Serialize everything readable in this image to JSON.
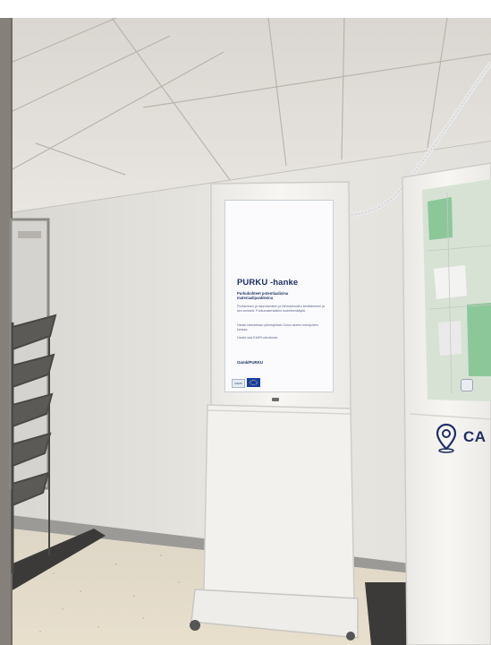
{
  "kiosk_screen": {
    "title": "PURKU -hanke",
    "subtitle": "Purkukohteet potentiaalisina materiaalipankkeina",
    "paragraph_1": "Purkamisen ja rakentamisen ja kiertotalouden kehittäminen ja sen arviointi. Purkumateriaalien uudelleenkäyttö.",
    "paragraph_2": "Hanke toteutetaan yhteistyössä Oulun alueen toimijoiden kanssa.",
    "paragraph_3": "Hanke saa EAKR-rahoitusta.",
    "link_text": "Oamk/PURKU",
    "logo_text": "OAMK"
  },
  "second_kiosk": {
    "label": "CA",
    "pin_icon": "location-pin-icon"
  },
  "colors": {
    "wall": "#e7e5e0",
    "ceiling": "#e4e1dd",
    "floor": "#e2d9c7",
    "kiosk": "#f4f3f0",
    "screen_text": "#1f2f66",
    "eu_blue": "#153ea6"
  }
}
